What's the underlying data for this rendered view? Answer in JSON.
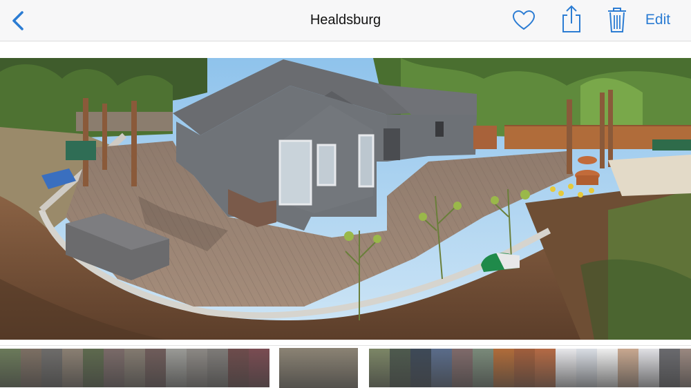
{
  "navbar": {
    "title": "Healdsburg",
    "edit_label": "Edit",
    "icons": {
      "back": "chevron-left-icon",
      "favorite": "heart-icon",
      "share": "share-icon",
      "delete": "trash-icon"
    },
    "accent_color": "#2b7cd3"
  },
  "photo": {
    "description_icon": "panorama-photo",
    "selected_index": 13
  },
  "thumbnail_strip": {
    "thumbnails": [
      {
        "color": "#6b7a5a"
      },
      {
        "color": "#7c6f63"
      },
      {
        "color": "#6e6c6a"
      },
      {
        "color": "#8a7f72"
      },
      {
        "color": "#5e6a4e"
      },
      {
        "color": "#7a6a68"
      },
      {
        "color": "#837a70"
      },
      {
        "color": "#6f5c5a"
      },
      {
        "color": "#9a9a96"
      },
      {
        "color": "#8c8884"
      },
      {
        "color": "#7e7b78"
      },
      {
        "color": "#6e4c4c"
      },
      {
        "color": "#7a4c52"
      },
      {
        "color": "#8b8374"
      },
      {
        "color": "#7c8666"
      },
      {
        "color": "#4e5a4e"
      },
      {
        "color": "#3e4a58"
      },
      {
        "color": "#5a6c8a"
      },
      {
        "color": "#7f6a6a"
      },
      {
        "color": "#7a8a7a"
      },
      {
        "color": "#b06c3a"
      },
      {
        "color": "#a05e3c"
      },
      {
        "color": "#b46a44"
      },
      {
        "color": "#e7e7ea"
      },
      {
        "color": "#d9dde4"
      },
      {
        "color": "#eeeeee"
      },
      {
        "color": "#c8a890"
      },
      {
        "color": "#e0e0e4"
      },
      {
        "color": "#6a6a6e"
      },
      {
        "color": "#9a8880"
      }
    ]
  }
}
